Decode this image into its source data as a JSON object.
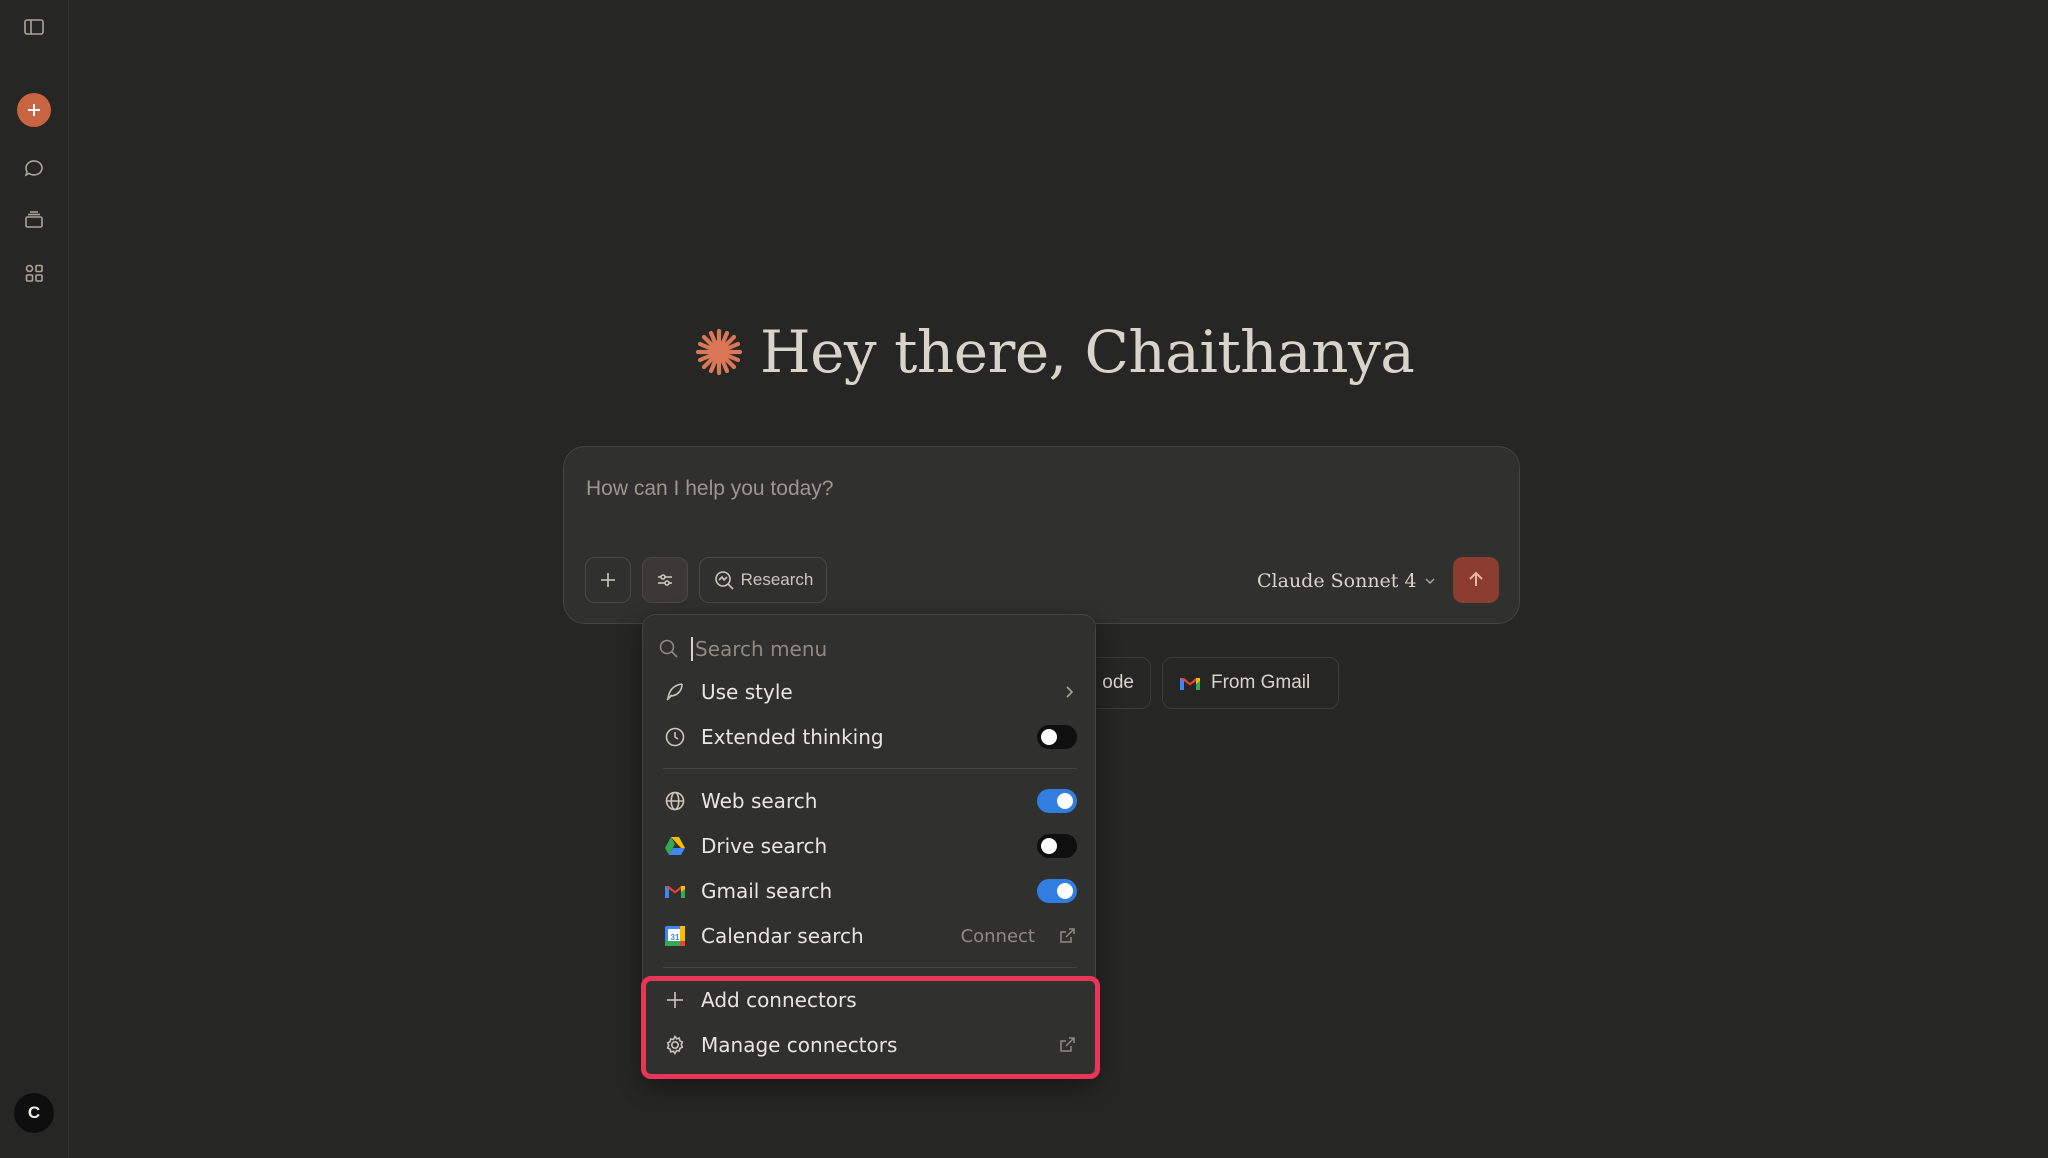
{
  "greeting": {
    "text": "Hey there, Chaithanya"
  },
  "composer": {
    "placeholder": "How can I help you today?",
    "research_label": "Research",
    "model_label": "Claude Sonnet 4"
  },
  "suggestions": [
    {
      "label": "ode",
      "icon": "code-icon"
    },
    {
      "label": "From Gmail",
      "icon": "gmail-icon"
    }
  ],
  "menu": {
    "search_placeholder": "Search menu",
    "items": [
      {
        "label": "Use style",
        "icon": "feather-icon",
        "trailing": "chevron"
      },
      {
        "label": "Extended thinking",
        "icon": "clock-icon",
        "toggle": false
      },
      {
        "label": "Web search",
        "icon": "globe-icon",
        "toggle": true
      },
      {
        "label": "Drive search",
        "icon": "google-drive-icon",
        "toggle": false
      },
      {
        "label": "Gmail search",
        "icon": "gmail-icon",
        "toggle": true
      },
      {
        "label": "Calendar search",
        "icon": "google-calendar-icon",
        "trailing": "Connect"
      },
      {
        "label": "Add connectors",
        "icon": "plus-icon"
      },
      {
        "label": "Manage connectors",
        "icon": "gear-icon",
        "trailing": "external"
      }
    ],
    "calendar_badge": "31"
  },
  "user": {
    "initial": "C"
  },
  "colors": {
    "background": "#262624",
    "accent": "#c96442",
    "send_button": "#8a3d30",
    "toggle_on": "#2f7ee0",
    "highlight": "#e8365a"
  }
}
